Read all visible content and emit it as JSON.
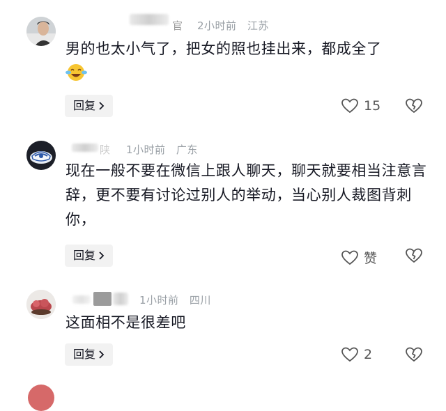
{
  "comments": [
    {
      "name_tail": "官",
      "time": "2小时前",
      "location": "江苏",
      "text": "男的也太小气了，把女的照也挂出来，都成全了",
      "has_emoji": true,
      "emoji_name": "laughing-crying-face",
      "reply_label": "回复",
      "like_count": "15"
    },
    {
      "name_tail": "陕",
      "time": "1小时前",
      "location": "广东",
      "text": "现在一般不要在微信上跟人聊天，聊天就要相当注意言辞，更不要有讨论过别人的举动，当心别人裁图背刺你，",
      "reply_label": "回复",
      "like_count": "赞"
    },
    {
      "name_tail": "",
      "time": "1小时前",
      "location": "四川",
      "text": "这面相不是很差吧",
      "reply_label": "回复",
      "like_count": "2"
    }
  ],
  "icons": {
    "like": "heart-outline-icon",
    "dislike": "broken-heart-icon",
    "reply_chevron": "chevron-right-icon"
  },
  "colors": {
    "text": "#161823",
    "meta": "#9aa0a6",
    "button_bg": "#f2f2f2"
  }
}
